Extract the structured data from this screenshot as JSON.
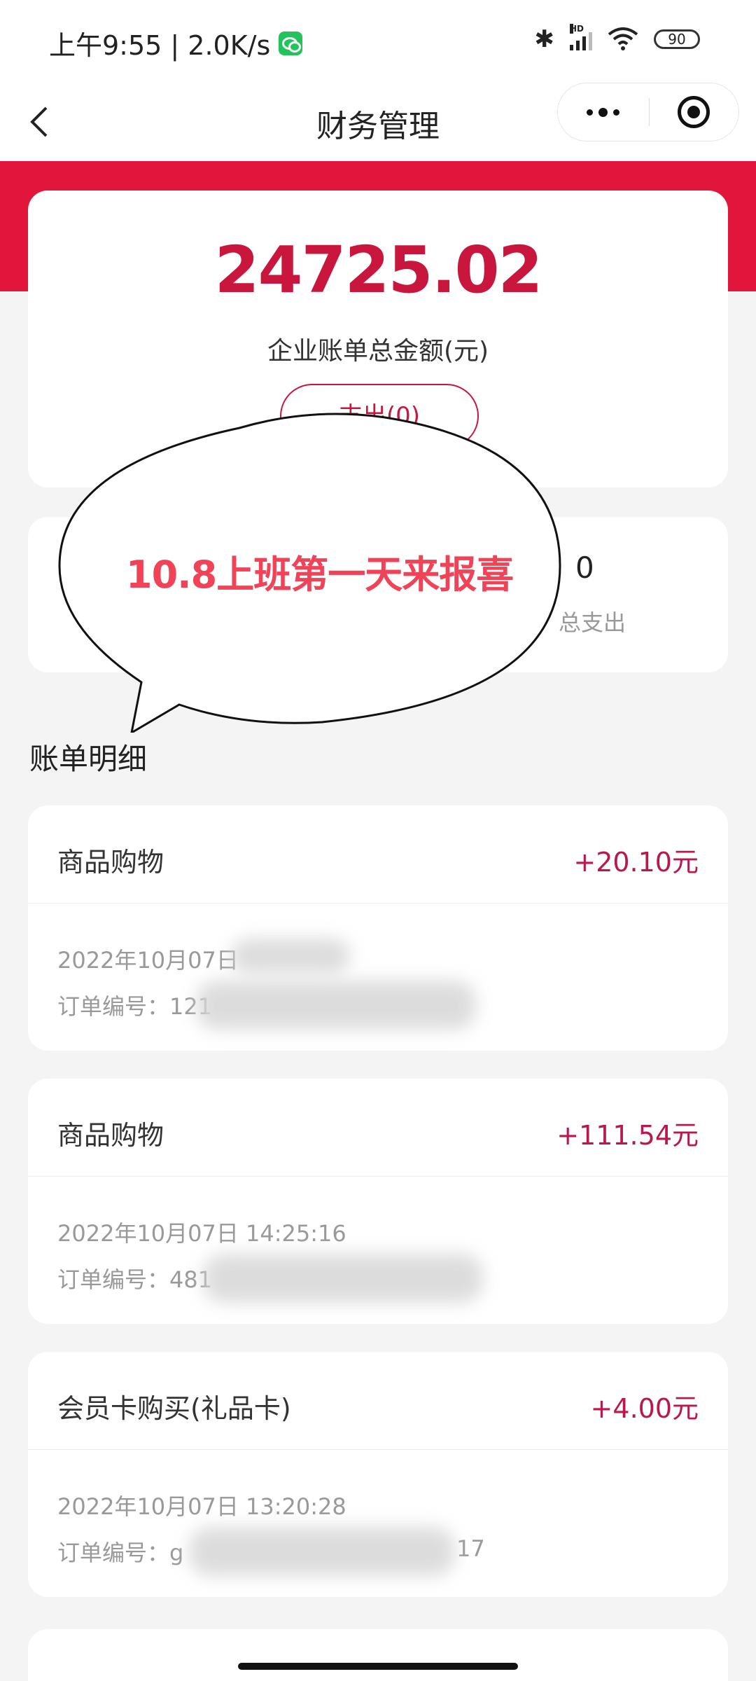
{
  "status_bar": {
    "time": "上午9:55 | 2.0K/s",
    "signal_label": "HD",
    "battery": "90"
  },
  "nav": {
    "title": "财务管理"
  },
  "summary": {
    "total_amount": "24725.02",
    "total_label": "企业账单总金额(元)",
    "button_label": "支出(0)"
  },
  "stats": {
    "expense_value": "0",
    "expense_label": "总支出"
  },
  "overlay": {
    "caption": "10.8上班第一天来报喜"
  },
  "section_title": "账单明细",
  "bills": [
    {
      "title": "商品购物",
      "amount": "+20.10元",
      "date": "2022年10月07日",
      "order": "订单编号：121"
    },
    {
      "title": "商品购物",
      "amount": "+111.54元",
      "date": "2022年10月07日 14:25:16",
      "order": "订单编号：481"
    },
    {
      "title": "会员卡购买(礼品卡)",
      "amount": "+4.00元",
      "date": "2022年10月07日 13:20:28",
      "order": "订单编号：g",
      "order_tail": "17"
    }
  ],
  "colors": {
    "brand_red": "#e2163c",
    "amount_red": "#b8184a",
    "caption_red": "#f04358"
  }
}
